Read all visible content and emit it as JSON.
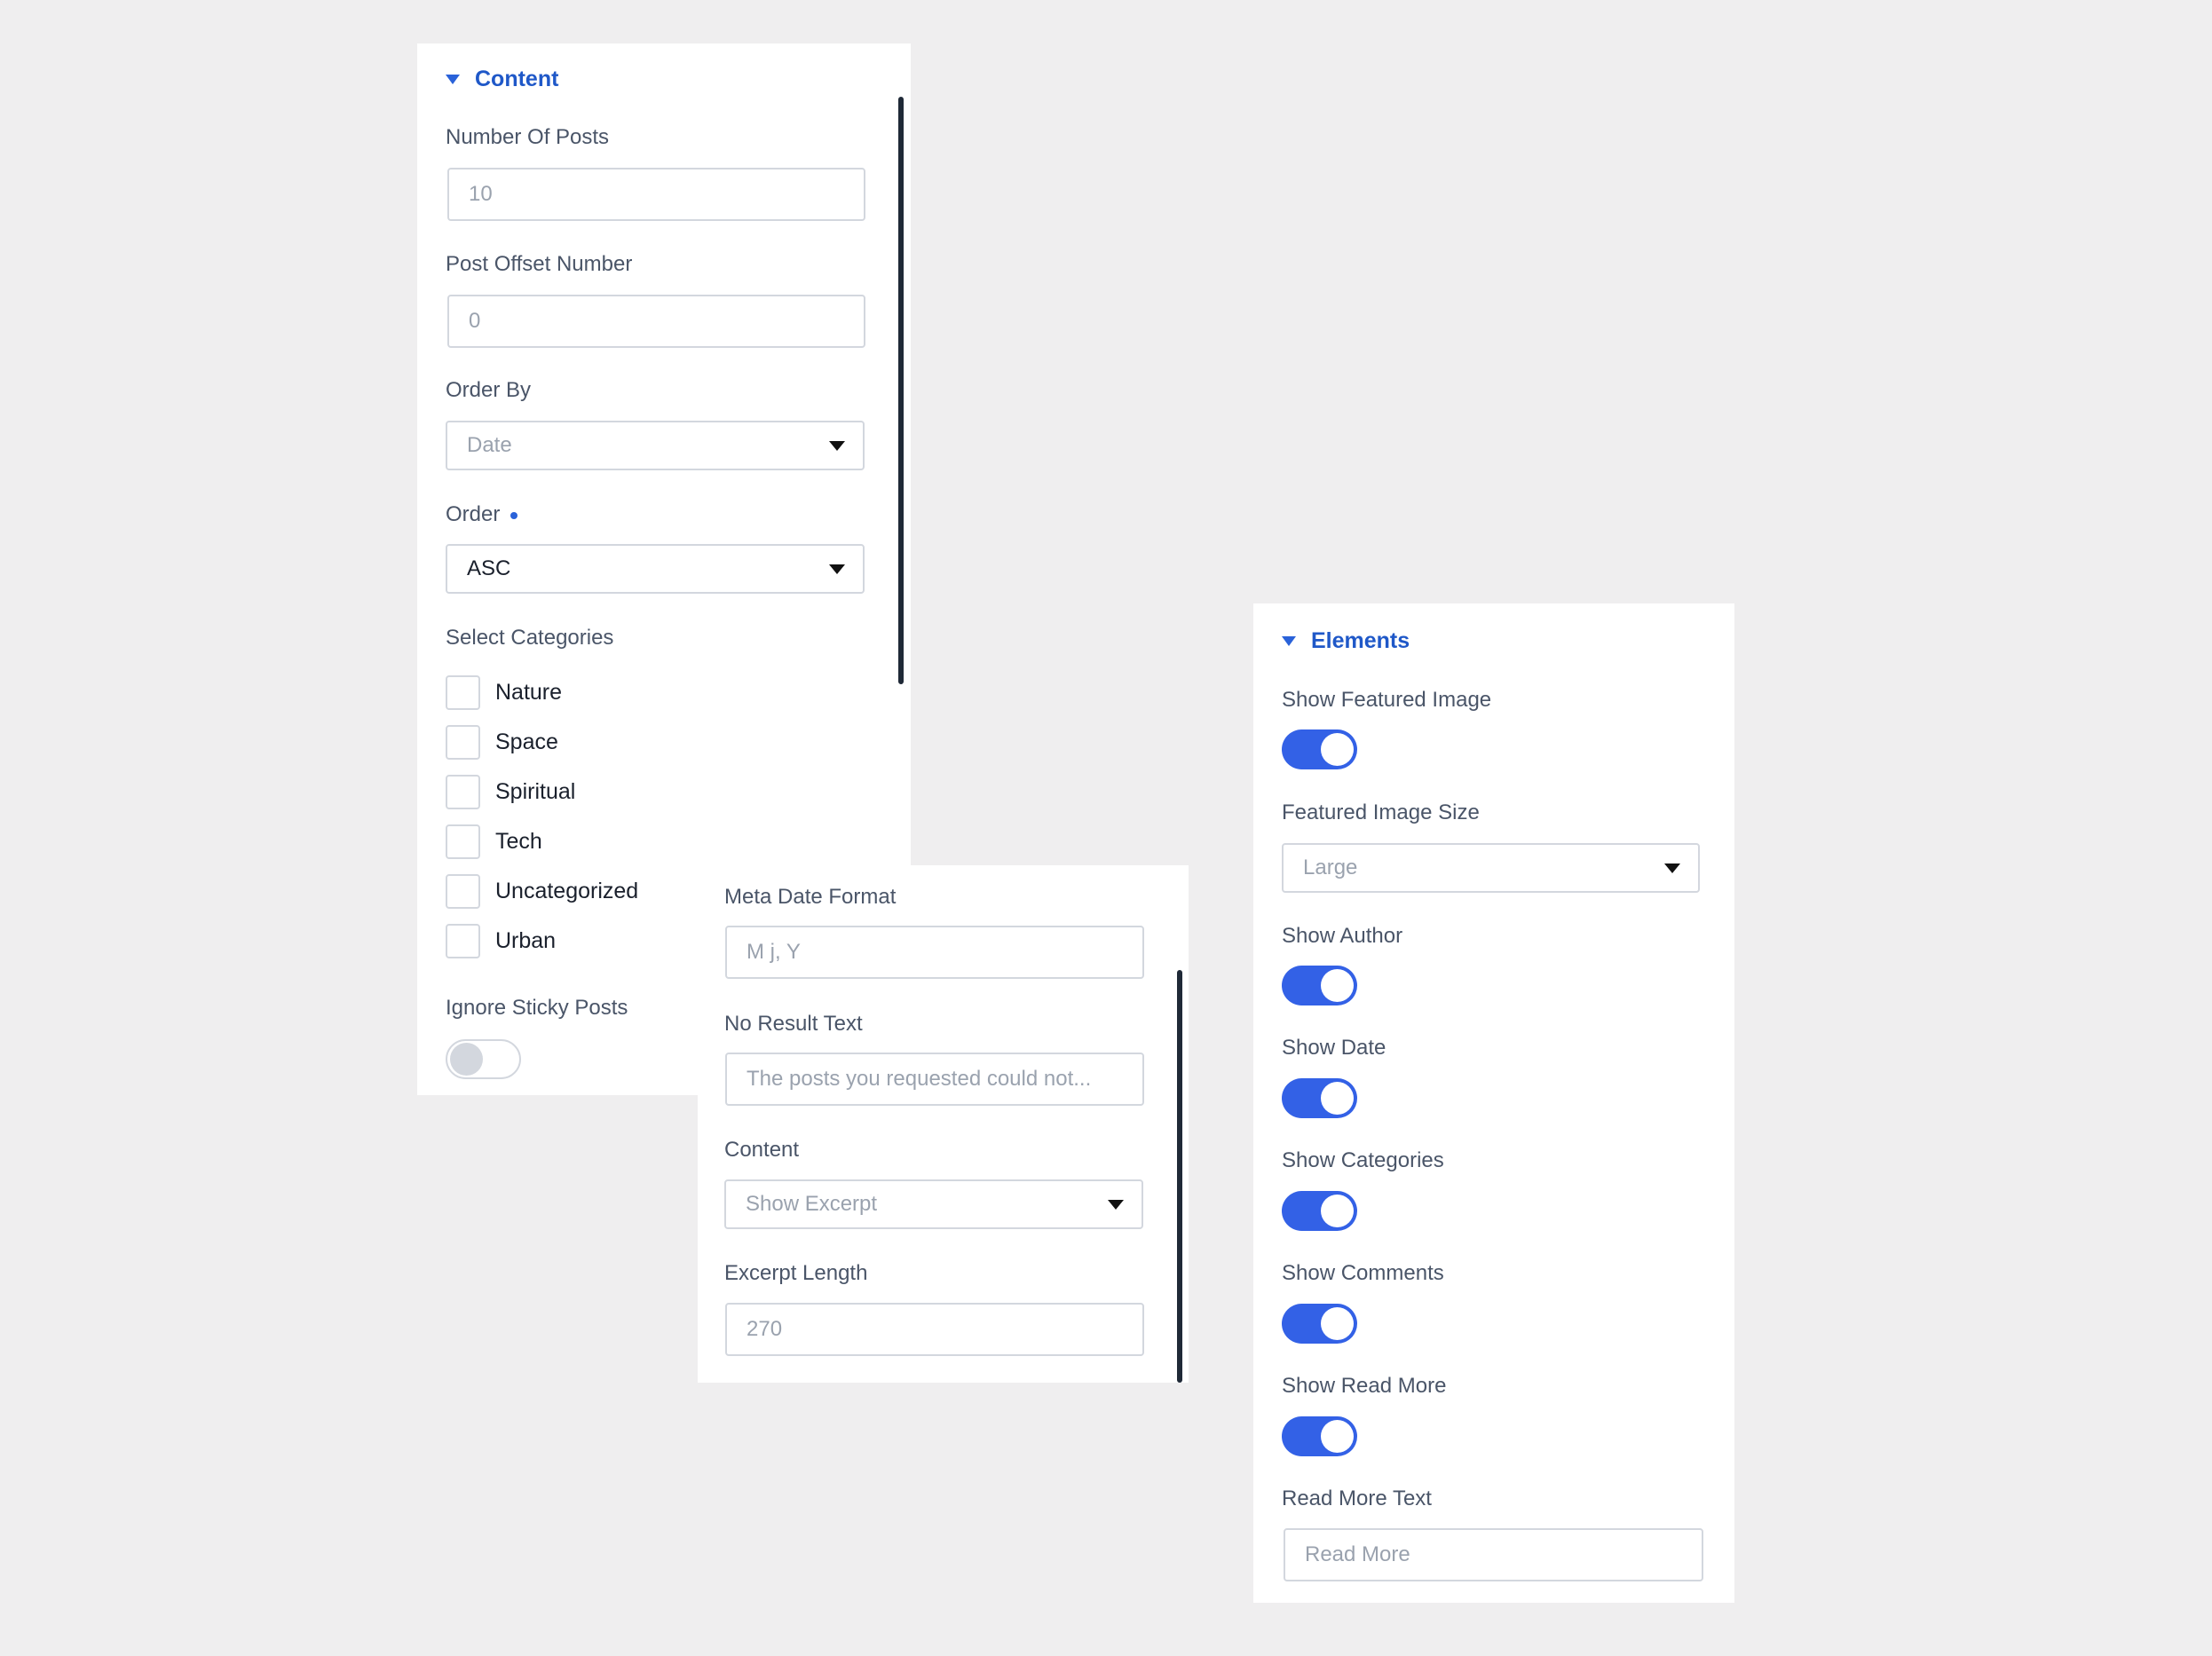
{
  "content_panel": {
    "section_title": "Content",
    "number_of_posts": {
      "label": "Number Of Posts",
      "value": "10"
    },
    "post_offset": {
      "label": "Post Offset Number",
      "value": "0"
    },
    "order_by": {
      "label": "Order By",
      "value": "Date"
    },
    "order": {
      "label": "Order",
      "value": "ASC"
    },
    "categories": {
      "label": "Select Categories",
      "items": [
        "Nature",
        "Space",
        "Spiritual",
        "Tech",
        "Uncategorized",
        "Urban"
      ]
    },
    "ignore_sticky": {
      "label": "Ignore Sticky Posts",
      "on": false
    }
  },
  "meta_panel": {
    "meta_date_format": {
      "label": "Meta Date Format",
      "placeholder": "M j, Y"
    },
    "no_result_text": {
      "label": "No Result Text",
      "placeholder": "The posts you requested could not..."
    },
    "content": {
      "label": "Content",
      "value": "Show Excerpt"
    },
    "excerpt_length": {
      "label": "Excerpt Length",
      "value": "270"
    }
  },
  "elements_panel": {
    "section_title": "Elements",
    "show_featured_image": {
      "label": "Show Featured Image",
      "on": true
    },
    "featured_image_size": {
      "label": "Featured Image Size",
      "value": "Large"
    },
    "show_author": {
      "label": "Show Author",
      "on": true
    },
    "show_date": {
      "label": "Show Date",
      "on": true
    },
    "show_categories": {
      "label": "Show Categories",
      "on": true
    },
    "show_comments": {
      "label": "Show Comments",
      "on": true
    },
    "show_read_more": {
      "label": "Show Read More",
      "on": true
    },
    "read_more_text": {
      "label": "Read More Text",
      "placeholder": "Read More"
    }
  },
  "colors": {
    "background": "#efeeef",
    "accent": "#3361e6",
    "section_title": "#1f58c8"
  }
}
